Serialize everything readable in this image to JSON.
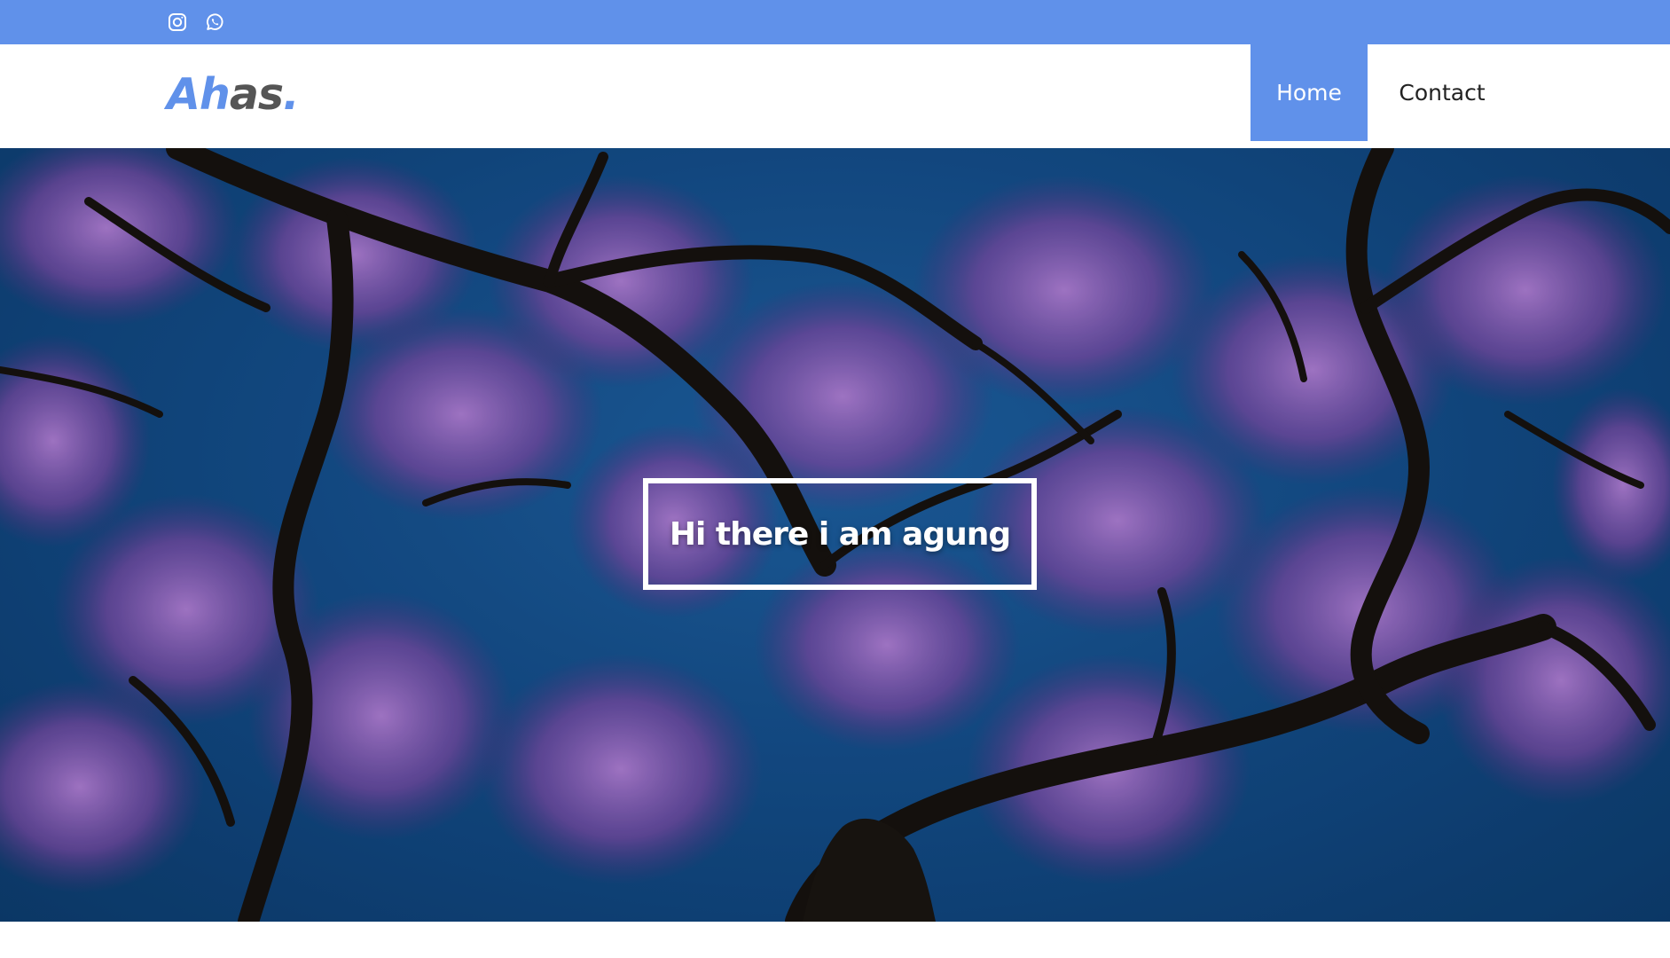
{
  "topbar": {
    "bg_color": "#6091ea",
    "social": [
      {
        "icon": "instagram-icon"
      },
      {
        "icon": "whatsapp-icon"
      }
    ]
  },
  "header": {
    "logo": {
      "part1": "Ah",
      "part2": "as",
      "part3": "."
    },
    "nav": [
      {
        "label": "Home",
        "active": true
      },
      {
        "label": "Contact",
        "active": false
      }
    ],
    "accent_color": "#6091ea"
  },
  "hero": {
    "title": "Hi there i am agung",
    "background": "blue sky with purple blossoming tree branches"
  }
}
